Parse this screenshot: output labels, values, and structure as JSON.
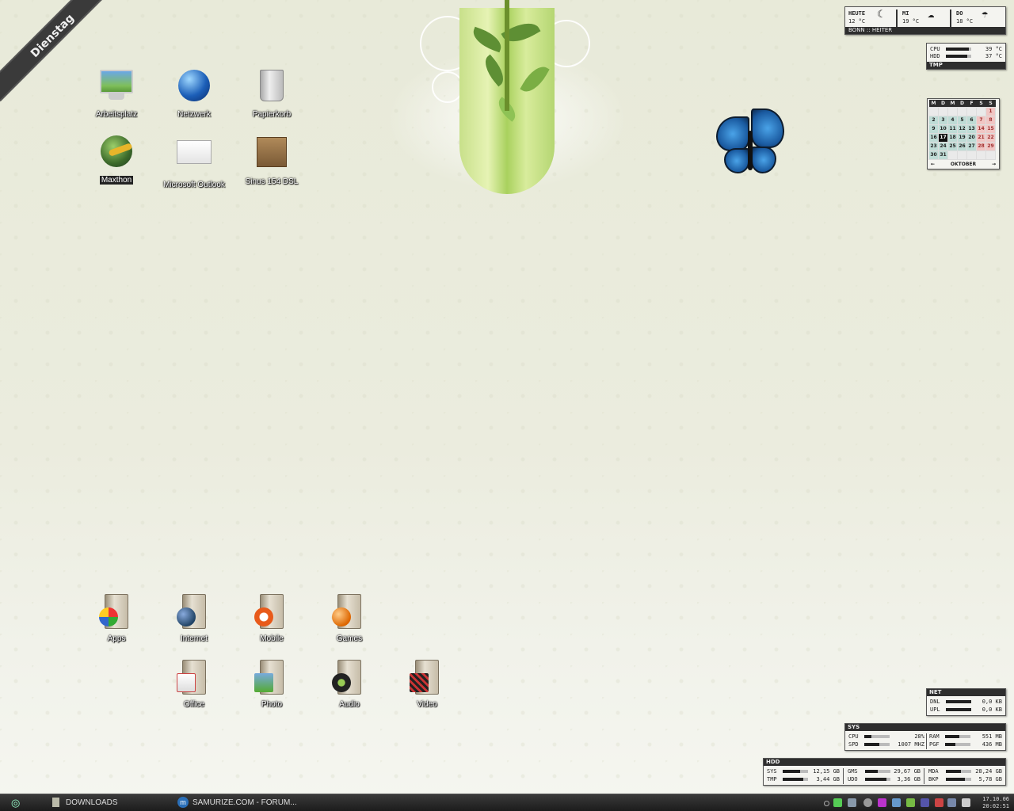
{
  "day_ribbon": "Dienstag",
  "desktop_icons": [
    {
      "label": "Arbeitsplatz",
      "icon": "computer-icon"
    },
    {
      "label": "Netzwerk",
      "icon": "network-globe-icon"
    },
    {
      "label": "Papierkorb",
      "icon": "recycle-bin-icon"
    },
    {
      "label": "Maxthon",
      "icon": "maxthon-browser-icon"
    },
    {
      "label": "Microsoft Outlook",
      "icon": "mail-envelope-icon"
    },
    {
      "label": "Sinus 154 DSL",
      "icon": "router-box-icon"
    }
  ],
  "folders": [
    {
      "label": "Apps",
      "icon": "windows-flag-icon"
    },
    {
      "label": "Internet",
      "icon": "globe-icon"
    },
    {
      "label": "Mobile",
      "icon": "mobile-icon"
    },
    {
      "label": "Games",
      "icon": "ball-icon"
    },
    {
      "label": "Office",
      "icon": "document-icon"
    },
    {
      "label": "Photo",
      "icon": "photo-icon"
    },
    {
      "label": "Audio",
      "icon": "music-note-icon"
    },
    {
      "label": "Video",
      "icon": "clapperboard-icon"
    }
  ],
  "weather": {
    "today_label": "HEUTE",
    "today_temp": "12 °C",
    "d1_label": "MI",
    "d1_temp": "19 °C",
    "d2_label": "DO",
    "d2_temp": "18 °C",
    "location": "BONN :: HEITER"
  },
  "temps": {
    "cpu_label": "CPU",
    "cpu_value": "39 °C",
    "hdd_label": "HDD",
    "hdd_value": "37 °C",
    "footer": "TMP"
  },
  "calendar": {
    "weekdays": [
      "M",
      "D",
      "M",
      "D",
      "F",
      "S",
      "S"
    ],
    "weeks": [
      [
        "",
        "",
        "",
        "",
        "",
        "",
        "1"
      ],
      [
        "2",
        "3",
        "4",
        "5",
        "6",
        "7",
        "8"
      ],
      [
        "9",
        "10",
        "11",
        "12",
        "13",
        "14",
        "15"
      ],
      [
        "16",
        "17",
        "18",
        "19",
        "20",
        "21",
        "22"
      ],
      [
        "23",
        "24",
        "25",
        "26",
        "27",
        "28",
        "29"
      ],
      [
        "30",
        "31",
        "",
        "",
        "",
        "",
        ""
      ]
    ],
    "today": "17",
    "month": "OKTOBER",
    "prev": "←",
    "next": "→"
  },
  "net": {
    "title": "NET",
    "dnl_label": "DNL",
    "dnl_value": "0,0 KB",
    "upl_label": "UPL",
    "upl_value": "0,0 KB"
  },
  "sys": {
    "title": "SYS",
    "cpu_label": "CPU",
    "cpu_value": "28%",
    "cpu_fraction": 0.28,
    "spd_label": "SPD",
    "spd_value": "1007 MHZ",
    "ram_label": "RAM",
    "ram_value": "551 MB",
    "pgf_label": "PGF",
    "pgf_value": "436 MB"
  },
  "hdd": {
    "title": "HDD",
    "drives": [
      {
        "label": "SYS",
        "value": "12,15 GB"
      },
      {
        "label": "TMP",
        "value": "3,44 GB"
      },
      {
        "label": "GMS",
        "value": "29,67 GB"
      },
      {
        "label": "UDO",
        "value": "3,36 GB"
      },
      {
        "label": "MDA",
        "value": "28,24 GB"
      },
      {
        "label": "BKP",
        "value": "5,78 GB"
      }
    ]
  },
  "taskbar": {
    "items": [
      {
        "label": "DOWNLOADS",
        "icon": "folder-icon"
      },
      {
        "label": "SAMURIZE.COM - FORUM...",
        "icon": "maxthon-m-icon"
      }
    ],
    "date": "17.10.06",
    "time": "20:02:51"
  },
  "colors": {
    "accent": "#2e2e2e",
    "panel_bg": "#f4f4f0",
    "calendar_weekday": "#bfdcd6",
    "calendar_weekend": "#f1c6c4"
  }
}
